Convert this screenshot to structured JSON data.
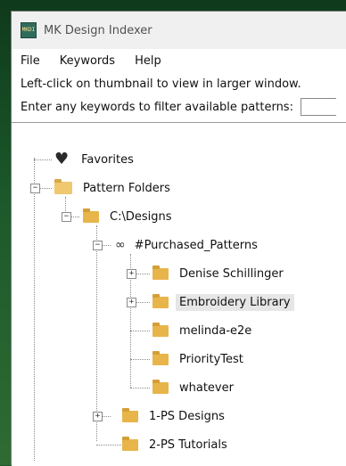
{
  "window": {
    "title": "MK Design Indexer",
    "app_icon_text": "MKDI"
  },
  "menu": {
    "items": [
      "File",
      "Keywords",
      "Help"
    ]
  },
  "info": {
    "line1": "Left-click on thumbnail to view in larger window.",
    "filter_label": "Enter any keywords to filter available patterns:",
    "filter_value": ""
  },
  "tree": {
    "favorites": "Favorites",
    "pattern_folders": "Pattern Folders",
    "root": "C:\\Designs",
    "purchased": "#Purchased_Patterns",
    "children": [
      {
        "label": "Denise Schillinger",
        "expandable": true
      },
      {
        "label": "Embroidery Library",
        "expandable": true,
        "selected": true
      },
      {
        "label": "melinda-e2e",
        "expandable": false
      },
      {
        "label": "PriorityTest",
        "expandable": false
      },
      {
        "label": "whatever",
        "expandable": false
      }
    ],
    "ps_designs": "1-PS Designs",
    "ps_tutorials": "2-PS Tutorials"
  },
  "colors": {
    "folder": "#e8b54a",
    "selected_bg": "#e6e6e6"
  }
}
